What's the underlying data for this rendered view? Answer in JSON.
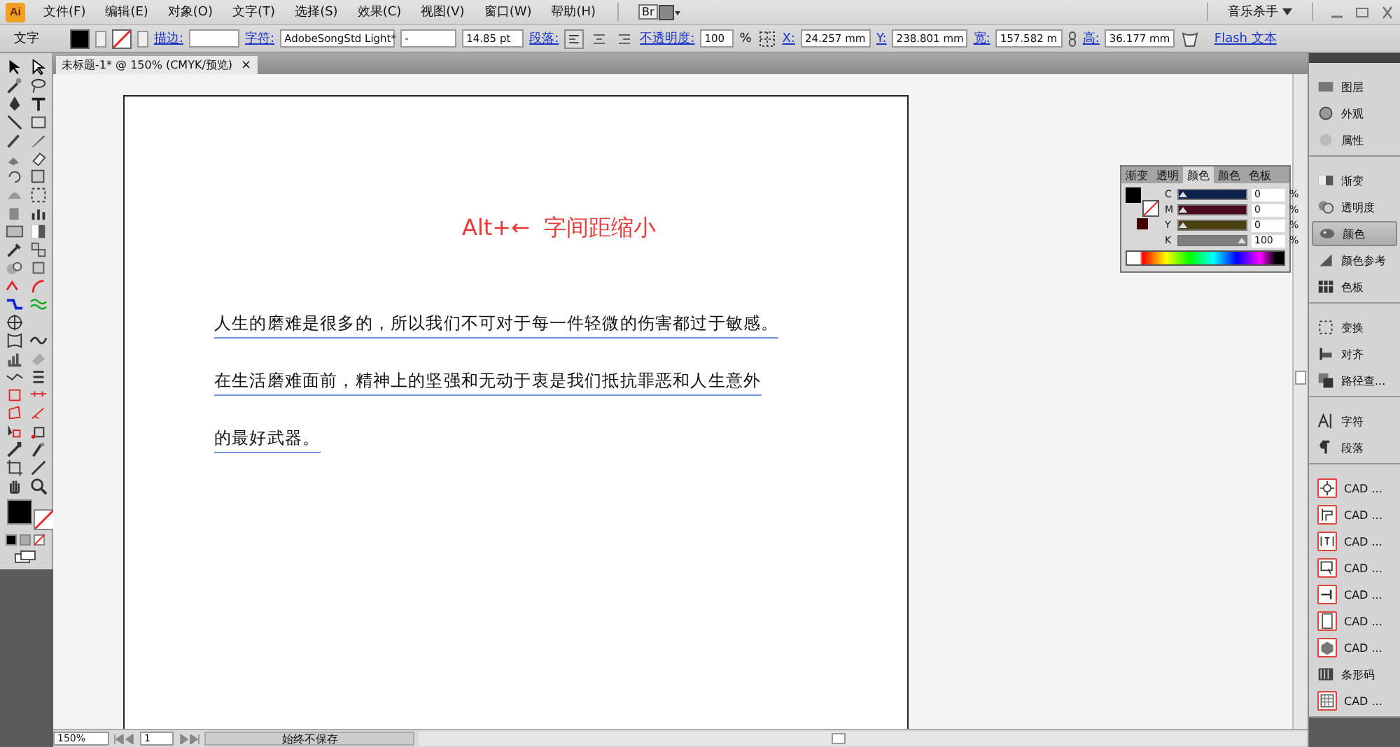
{
  "menu_bar": {
    "logo": "Ai",
    "items": [
      "文件(F)",
      "编辑(E)",
      "对象(O)",
      "文字(T)",
      "选择(S)",
      "效果(C)",
      "视图(V)",
      "窗口(W)",
      "帮助(H)"
    ],
    "bridge": "Br",
    "workspace": "音乐杀手"
  },
  "control_bar": {
    "tool": "文字",
    "stroke_label": "描边:",
    "char_label": "字符:",
    "font": "AdobeSongStd Light*",
    "style": "-",
    "size": "14.85 pt",
    "para_label": "段落:",
    "opacity_label": "不透明度:",
    "opacity": "100",
    "percent": "%",
    "x_label": "X:",
    "x": "24.257 mm",
    "y_label": "Y:",
    "y": "238.801 mm",
    "w_label": "宽:",
    "w": "157.582 m",
    "h_label": "高:",
    "h": "36.177 mm",
    "flash": "Flash 文本"
  },
  "document_tab": {
    "title": "未标题-1* @ 150% (CMYK/预览)",
    "close": "×"
  },
  "artboard": {
    "heading": "Alt+←  字间距缩小",
    "paragraph_lines": [
      "人生的磨难是很多的，所以我们不可对于每一件轻微的伤害都过于敏感。",
      "在生活磨难面前，精神上的坚强和无动于衷是我们抵抗罪恶和人生意外",
      "的最好武器。"
    ]
  },
  "color_panel": {
    "tabs": [
      {
        "label": "渐变",
        "selected": false
      },
      {
        "label": "透明",
        "selected": false
      },
      {
        "label": "颜色",
        "selected": true
      },
      {
        "label": "颜色",
        "selected": false
      },
      {
        "label": "色板",
        "selected": false
      }
    ],
    "channels": [
      {
        "name": "C",
        "value": "0",
        "percent": "%",
        "level": 0,
        "color": "#0a1f4a"
      },
      {
        "name": "M",
        "value": "0",
        "percent": "%",
        "level": 0,
        "color": "#4a0a20"
      },
      {
        "name": "Y",
        "value": "0",
        "percent": "%",
        "level": 0,
        "color": "#4a4010"
      },
      {
        "name": "K",
        "value": "100",
        "percent": "%",
        "level": 1,
        "color": "#808080"
      }
    ]
  },
  "dock": {
    "groups": [
      [
        {
          "label": "图层",
          "selected": false,
          "kind": "plain"
        },
        {
          "label": "外观",
          "selected": false,
          "kind": "plain"
        },
        {
          "label": "属性",
          "selected": false,
          "kind": "plain"
        }
      ],
      [
        {
          "label": "渐变",
          "selected": false,
          "kind": "plain"
        },
        {
          "label": "透明度",
          "selected": false,
          "kind": "plain"
        },
        {
          "label": "颜色",
          "selected": true,
          "kind": "plain"
        },
        {
          "label": "颜色参考",
          "selected": false,
          "kind": "plain"
        },
        {
          "label": "色板",
          "selected": false,
          "kind": "plain"
        }
      ],
      [
        {
          "label": "变换",
          "selected": false,
          "kind": "plain"
        },
        {
          "label": "对齐",
          "selected": false,
          "kind": "plain"
        },
        {
          "label": "路径查...",
          "selected": false,
          "kind": "plain"
        }
      ],
      [
        {
          "label": "字符",
          "selected": false,
          "kind": "plain"
        },
        {
          "label": "段落",
          "selected": false,
          "kind": "plain"
        }
      ],
      [
        {
          "label": "CAD ...",
          "selected": false,
          "kind": "cad"
        },
        {
          "label": "CAD ...",
          "selected": false,
          "kind": "cad"
        },
        {
          "label": "CAD ...",
          "selected": false,
          "kind": "cad"
        },
        {
          "label": "CAD ...",
          "selected": false,
          "kind": "cad"
        },
        {
          "label": "CAD ...",
          "selected": false,
          "kind": "cad"
        },
        {
          "label": "CAD ...",
          "selected": false,
          "kind": "cad"
        },
        {
          "label": "CAD ...",
          "selected": false,
          "kind": "cad"
        },
        {
          "label": "条形码",
          "selected": false,
          "kind": "plain"
        },
        {
          "label": "CAD ...",
          "selected": false,
          "kind": "cad"
        }
      ]
    ]
  },
  "status_bar": {
    "zoom": "150%",
    "page": "1",
    "save_state": "始终不保存"
  }
}
